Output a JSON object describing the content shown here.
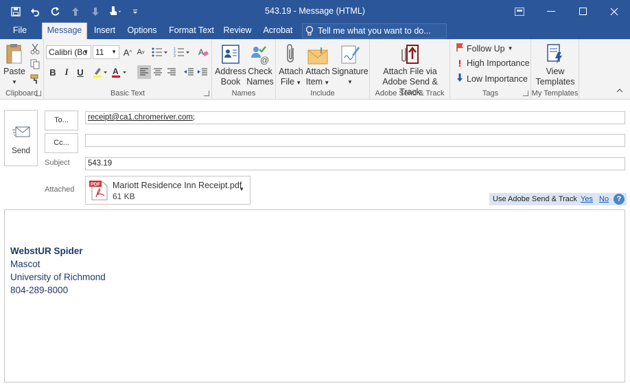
{
  "window": {
    "title": "543.19  -  Message (HTML)"
  },
  "colors": {
    "accent": "#2b579a",
    "ribbon_bg": "#f3f3f3",
    "signature": "#1f3864",
    "adobe_bar": "#dbe5f1"
  },
  "qat": {
    "icons": [
      "save-icon",
      "undo-icon",
      "redo-icon",
      "up-arrow-icon",
      "down-arrow-icon",
      "touch-mode-icon",
      "customize-icon"
    ]
  },
  "tabs": [
    {
      "label": "File"
    },
    {
      "label": "Message",
      "active": true
    },
    {
      "label": "Insert"
    },
    {
      "label": "Options"
    },
    {
      "label": "Format Text"
    },
    {
      "label": "Review"
    },
    {
      "label": "Acrobat"
    }
  ],
  "tell_me": {
    "placeholder": "Tell me what you want to do..."
  },
  "ribbon": {
    "clipboard": {
      "paste": "Paste",
      "label": "Clipboard"
    },
    "basic_text": {
      "font": "Calibri (Bo",
      "size": "11",
      "bold": "B",
      "italic": "I",
      "underline": "U",
      "label": "Basic Text"
    },
    "names": {
      "address_book_1": "Address",
      "address_book_2": "Book",
      "check_names_1": "Check",
      "check_names_2": "Names",
      "label": "Names"
    },
    "include": {
      "attach_file_1": "Attach",
      "attach_file_2": "File",
      "attach_item_1": "Attach",
      "attach_item_2": "Item",
      "signature": "Signature",
      "label": "Include"
    },
    "adobe": {
      "line1": "Attach File via",
      "line2": "Adobe Send & Track",
      "label": "Adobe Send & Track"
    },
    "tags": {
      "follow_up": "Follow Up",
      "high": "High Importance",
      "low": "Low Importance",
      "label": "Tags"
    },
    "templates": {
      "line1": "View",
      "line2": "Templates",
      "label": "My Templates"
    }
  },
  "compose": {
    "send_label": "Send",
    "to_label": "To...",
    "cc_label": "Cc...",
    "to_value": "receipt@ca1.chromeriver.com",
    "to_separator": ";",
    "cc_value": "",
    "subject_label": "Subject",
    "subject_value": "543.19",
    "attached_label": "Attached",
    "attachment": {
      "name": "Mariott Residence Inn Receipt.pdf",
      "size": "61 KB",
      "icon_text": "PDF"
    },
    "adobe_bar": {
      "text": "Use Adobe Send & Track",
      "yes": "Yes",
      "no": "No",
      "help": "?"
    }
  },
  "signature": {
    "name": "WebstUR Spider",
    "title": "Mascot",
    "org": "University of Richmond",
    "phone": "804-289-8000"
  }
}
